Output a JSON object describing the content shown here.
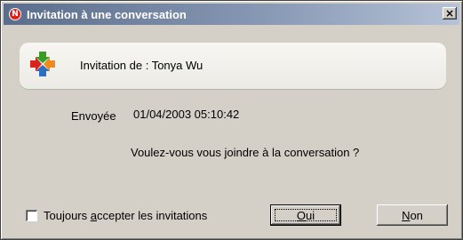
{
  "window": {
    "title": "Invitation à une conversation",
    "close_glyph": "×",
    "logo_letter": "N"
  },
  "header": {
    "invite_from": "Invitation de : Tonya Wu",
    "icon": "four-arrows-icon"
  },
  "details": {
    "sent_label": "Envoyée",
    "sent_value": "01/04/2003 05:10:42",
    "question": "Voulez-vous vous joindre à la conversation ?"
  },
  "options": {
    "always_accept_prefix": "Toujours ",
    "always_accept_mnemonic": "a",
    "always_accept_suffix": "ccepter les invitations",
    "always_accept_checked": false
  },
  "buttons": {
    "yes_mnemonic": "O",
    "yes_rest": "ui",
    "no_mnemonic": "N",
    "no_rest": "on"
  },
  "colors": {
    "titlebar_start": "#5a6d8c",
    "titlebar_end": "#b6c2d6",
    "dialog_bg": "#d4d0c8",
    "arrow_red": "#d8241f",
    "arrow_green": "#3c9a2a",
    "arrow_orange": "#f08a1c",
    "arrow_blue": "#2a6fc2"
  }
}
